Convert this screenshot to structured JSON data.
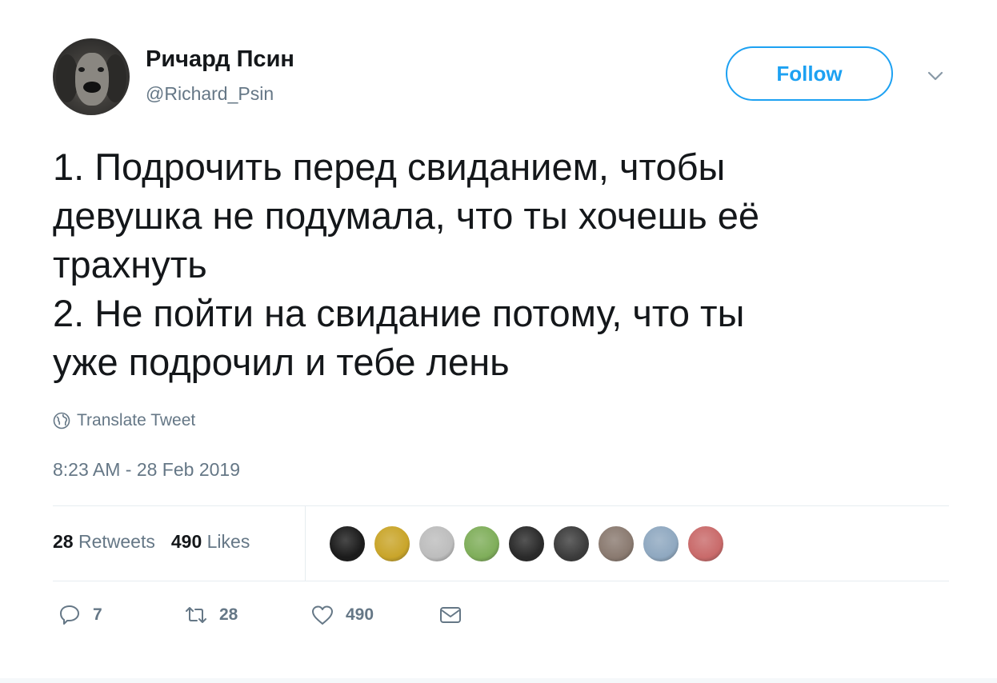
{
  "user": {
    "name": "Ричард Псин",
    "handle": "@Richard_Psin"
  },
  "follow_button": {
    "label": "Follow"
  },
  "tweet": {
    "text": "1. Подрочить перед свиданием, чтобы\nдевушка не подумала, что ты хочешь её\nтрахнуть\n2. Не пойти на свидание потому, что ты\nуже подрочил и тебе лень",
    "translate_label": "Translate Tweet",
    "timestamp": "8:23 AM - 28 Feb 2019"
  },
  "stats": {
    "retweets_count": "28",
    "retweets_label": "Retweets",
    "likes_count": "490",
    "likes_label": "Likes"
  },
  "likers": [
    {
      "color": "#1b1b1b"
    },
    {
      "color": "#c9a52a"
    },
    {
      "color": "#bdbdbd"
    },
    {
      "color": "#7fae5a"
    },
    {
      "color": "#2a2a2a"
    },
    {
      "color": "#3c3c3c"
    },
    {
      "color": "#8a7a70"
    },
    {
      "color": "#8fa8c0"
    },
    {
      "color": "#c96a6a"
    }
  ],
  "actions": {
    "reply_count": "7",
    "retweet_count": "28",
    "like_count": "490"
  },
  "colors": {
    "accent": "#1da1f2",
    "text": "#14171a",
    "secondary": "#657786"
  }
}
